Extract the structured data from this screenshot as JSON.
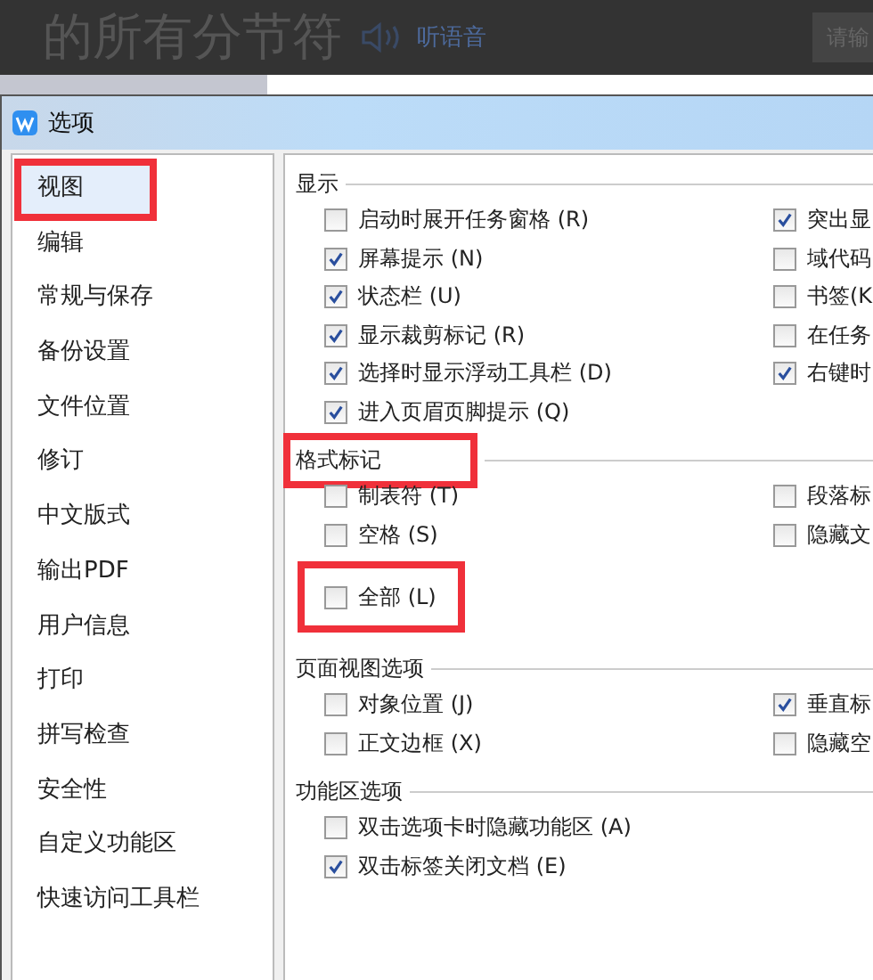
{
  "background_page": {
    "heading": "的所有分节符",
    "audio_link": "听语音",
    "search": {
      "placeholder": "请输"
    }
  },
  "window": {
    "title": "选项"
  },
  "sidebar": {
    "items": [
      {
        "label": "视图",
        "selected": true,
        "highlighted": true
      },
      {
        "label": "编辑",
        "selected": false,
        "highlighted": false
      },
      {
        "label": "常规与保存",
        "selected": false,
        "highlighted": false
      },
      {
        "label": "备份设置",
        "selected": false,
        "highlighted": false
      },
      {
        "label": "文件位置",
        "selected": false,
        "highlighted": false
      },
      {
        "label": "修订",
        "selected": false,
        "highlighted": false
      },
      {
        "label": "中文版式",
        "selected": false,
        "highlighted": false
      },
      {
        "label": "输出PDF",
        "selected": false,
        "highlighted": false
      },
      {
        "label": "用户信息",
        "selected": false,
        "highlighted": false
      },
      {
        "label": "打印",
        "selected": false,
        "highlighted": false
      },
      {
        "label": "拼写检查",
        "selected": false,
        "highlighted": false
      },
      {
        "label": "安全性",
        "selected": false,
        "highlighted": false
      },
      {
        "label": "自定义功能区",
        "selected": false,
        "highlighted": false
      },
      {
        "label": "快速访问工具栏",
        "selected": false,
        "highlighted": false
      }
    ]
  },
  "sections": [
    {
      "title": "显示",
      "highlighted": false,
      "left": [
        {
          "label": "启动时展开任务窗格 (R)",
          "checked": false,
          "highlighted": false
        },
        {
          "label": "屏幕提示 (N)",
          "checked": true,
          "highlighted": false
        },
        {
          "label": "状态栏 (U)",
          "checked": true,
          "highlighted": false
        },
        {
          "label": "显示裁剪标记 (R)",
          "checked": true,
          "highlighted": false
        },
        {
          "label": "选择时显示浮动工具栏 (D)",
          "checked": true,
          "highlighted": false
        },
        {
          "label": "进入页眉页脚提示 (Q)",
          "checked": true,
          "highlighted": false
        }
      ],
      "right": [
        {
          "label": "突出显",
          "checked": true,
          "highlighted": false
        },
        {
          "label": "域代码",
          "checked": false,
          "highlighted": false
        },
        {
          "label": "书签(K",
          "checked": false,
          "highlighted": false
        },
        {
          "label": "在任务",
          "checked": false,
          "highlighted": false
        },
        {
          "label": "右键时",
          "checked": true,
          "highlighted": false
        }
      ]
    },
    {
      "title": "格式标记",
      "highlighted": true,
      "left": [
        {
          "label": "制表符 (T)",
          "checked": false,
          "highlighted": false
        },
        {
          "label": "空格 (S)",
          "checked": false,
          "highlighted": false
        },
        {
          "label": "全部 (L)",
          "checked": false,
          "highlighted": true
        }
      ],
      "right": [
        {
          "label": "段落标",
          "checked": false,
          "highlighted": false
        },
        {
          "label": "隐藏文",
          "checked": false,
          "highlighted": false
        }
      ]
    },
    {
      "title": "页面视图选项",
      "highlighted": false,
      "left": [
        {
          "label": "对象位置 (J)",
          "checked": false,
          "highlighted": false
        },
        {
          "label": "正文边框 (X)",
          "checked": false,
          "highlighted": false
        }
      ],
      "right": [
        {
          "label": "垂直标",
          "checked": true,
          "highlighted": false
        },
        {
          "label": "隐藏空",
          "checked": false,
          "highlighted": false
        }
      ]
    },
    {
      "title": "功能区选项",
      "highlighted": false,
      "left": [
        {
          "label": "双击选项卡时隐藏功能区 (A)",
          "checked": false,
          "highlighted": false
        },
        {
          "label": "双击标签关闭文档 (E)",
          "checked": true,
          "highlighted": false
        }
      ]
    }
  ]
}
